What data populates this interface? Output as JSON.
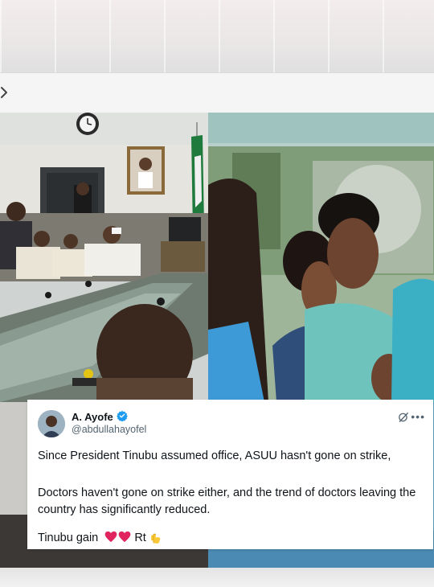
{
  "tweet": {
    "display_name": "A. Ayofe",
    "handle": "@abdullahayofel",
    "verified": true,
    "paragraphs": [
      "Since President Tinubu assumed office, ASUU hasn't gone on strike,",
      "Doctors haven't gone on strike either, and the trend of doctors leaving the country has significantly reduced.",
      "Tinubu gain"
    ],
    "trailing_text": "Rt",
    "emojis": [
      "red-heart",
      "red-heart",
      "backhand-index-pointing-down"
    ]
  },
  "icons": {
    "toolbar": "chevron-right-icon",
    "verified": "verified-badge-icon",
    "grok": "grok-icon",
    "more": "more-icon"
  },
  "colors": {
    "verified_blue": "#1d9bf0",
    "text_primary": "#0f1419",
    "text_secondary": "#536471",
    "heart_red": "#e0245e",
    "scrub_teal": "#5fc3c9"
  }
}
